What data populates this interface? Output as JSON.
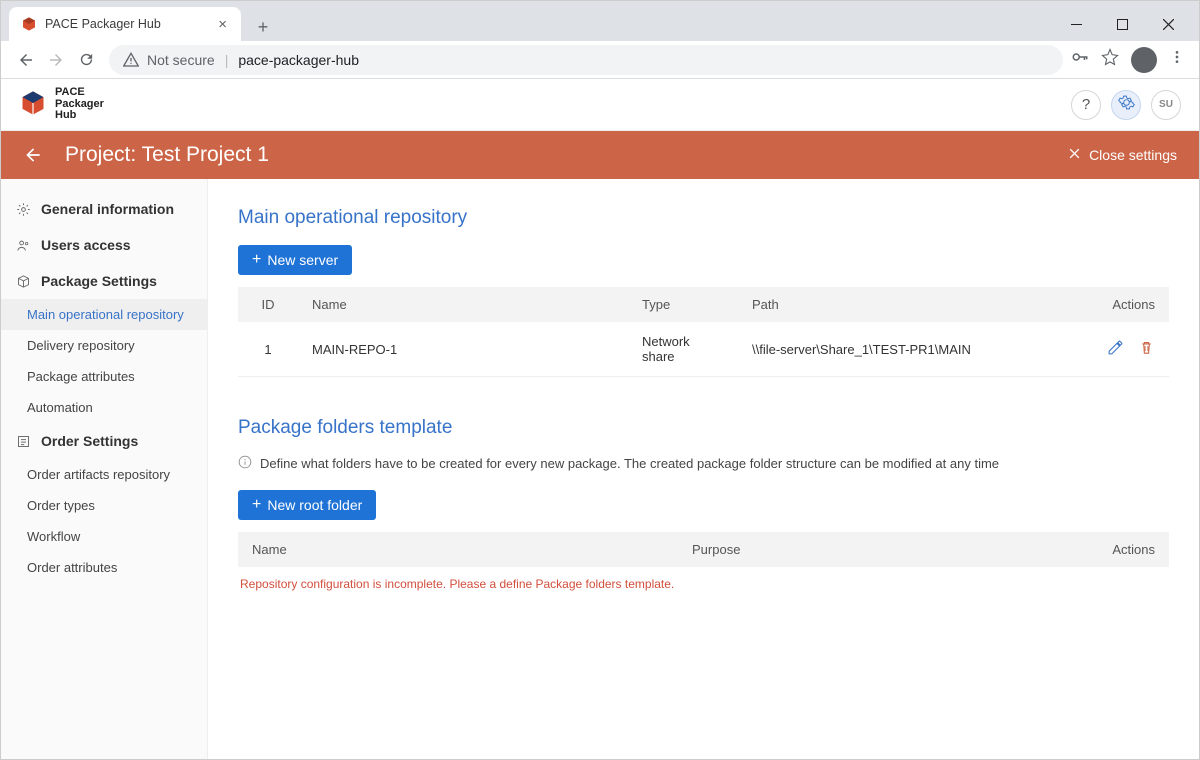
{
  "browser": {
    "tab_title": "PACE Packager Hub",
    "not_secure": "Not secure",
    "url": "pace-packager-hub"
  },
  "app": {
    "logo_line1": "PACE",
    "logo_line2": "Packager",
    "logo_line3": "Hub",
    "user_initials": "SU"
  },
  "orange": {
    "title": "Project: Test Project 1",
    "close": "Close settings"
  },
  "sidebar": {
    "general": "General information",
    "users": "Users access",
    "pkg_settings": "Package Settings",
    "pkg_items": {
      "main_repo": "Main operational repository",
      "delivery_repo": "Delivery repository",
      "pkg_attrs": "Package attributes",
      "automation": "Automation"
    },
    "order_settings": "Order Settings",
    "order_items": {
      "artifacts": "Order artifacts repository",
      "types": "Order types",
      "workflow": "Workflow",
      "attrs": "Order attributes"
    }
  },
  "sections": {
    "main_repo": {
      "title": "Main operational repository",
      "new_btn": "New server",
      "cols": {
        "id": "ID",
        "name": "Name",
        "type": "Type",
        "path": "Path",
        "actions": "Actions"
      },
      "rows": [
        {
          "id": "1",
          "name": "MAIN-REPO-1",
          "type": "Network share",
          "path": "\\\\file-server\\Share_1\\TEST-PR1\\MAIN"
        }
      ]
    },
    "folders": {
      "title": "Package folders template",
      "info": "Define what folders have to be created for every new package. The created package folder structure can be modified at any time",
      "new_btn": "New root folder",
      "cols": {
        "name": "Name",
        "purpose": "Purpose",
        "actions": "Actions"
      },
      "error": "Repository configuration is incomplete. Please a define Package folders template."
    }
  }
}
